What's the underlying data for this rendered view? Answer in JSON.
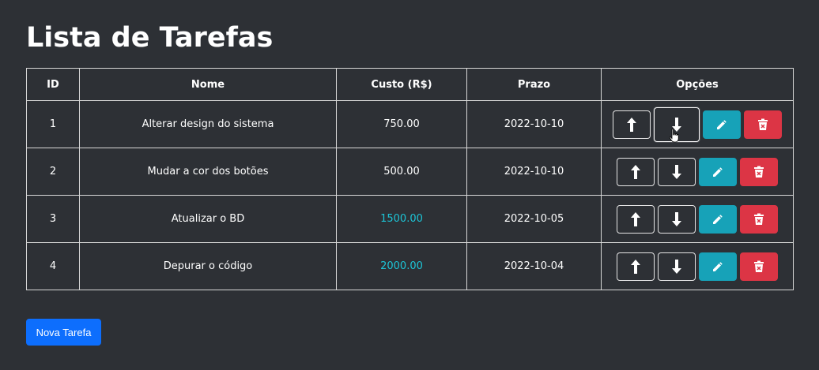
{
  "page": {
    "title": "Lista de Tarefas",
    "new_task_label": "Nova Tarefa"
  },
  "table": {
    "headers": [
      "ID",
      "Nome",
      "Custo (R$)",
      "Prazo",
      "Opções"
    ],
    "rows": [
      {
        "id": "1",
        "name": "Alterar design do sistema",
        "cost": "750.00",
        "deadline": "2022-10-10"
      },
      {
        "id": "2",
        "name": "Mudar a cor dos botões",
        "cost": "500.00",
        "deadline": "2022-10-10"
      },
      {
        "id": "3",
        "name": "Atualizar o BD",
        "cost": "1500.00",
        "deadline": "2022-10-05"
      },
      {
        "id": "4",
        "name": "Depurar o código",
        "cost": "2000.00",
        "deadline": "2022-10-04"
      }
    ]
  },
  "icons": {
    "move_up": "arrow-up-icon",
    "move_down": "arrow-down-icon",
    "edit": "pencil-icon",
    "delete": "trash-icon"
  },
  "colors": {
    "background": "#2d3035",
    "high_cost_text": "#1dc4d6",
    "edit_button": "#17a2b8",
    "delete_button": "#dc3545",
    "primary_button": "#0d6efd"
  }
}
